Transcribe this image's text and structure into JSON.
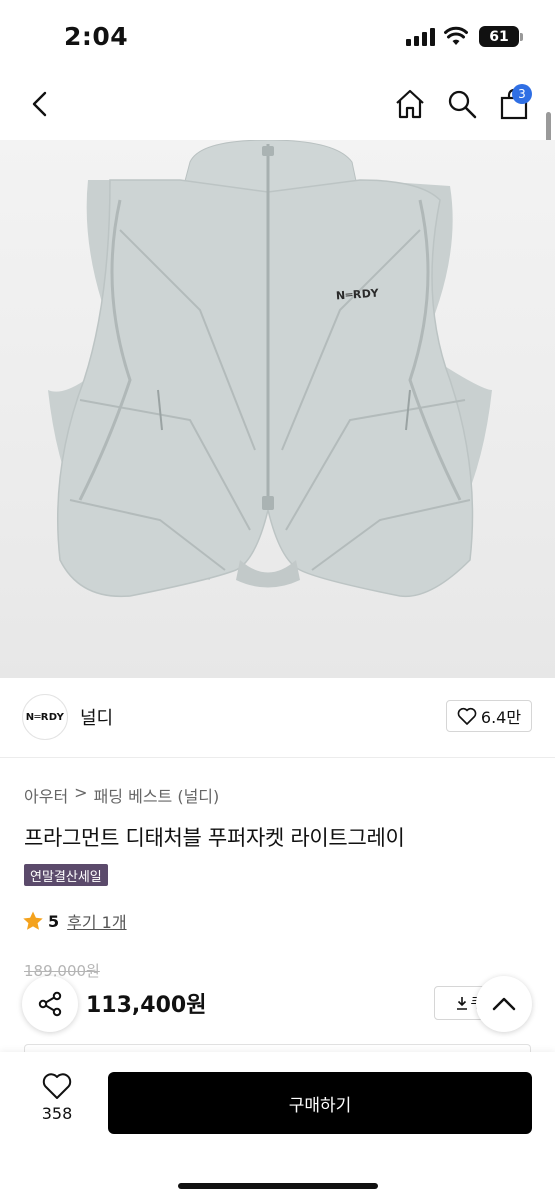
{
  "status_bar": {
    "time": "2:04",
    "battery": "61"
  },
  "nav": {
    "cart_count": "3"
  },
  "product_image": {
    "logo_text": "N═RDY"
  },
  "brand": {
    "logo_text": "N═RDY",
    "name": "널디",
    "like_count": "6.4만"
  },
  "breadcrumb": {
    "category": "아우터",
    "separator": ">",
    "subcategory": "패딩 베스트 (널디)"
  },
  "product": {
    "title": "프라그먼트 디태처블 푸퍼자켓 라이트그레이",
    "sale_badge": "연말결산세일",
    "rating": "5",
    "review_label": "후기 1개",
    "original_price": "189,000원",
    "sale_price": "113,400원",
    "coupon_label": "쿠"
  },
  "bottom_bar": {
    "wish_count": "358",
    "buy_label": "구매하기"
  },
  "colors": {
    "badge_blue": "#2f6fe4",
    "sale_badge_bg": "#5b4a6b",
    "star": "#f4a21d",
    "buy_button": "#000000"
  }
}
